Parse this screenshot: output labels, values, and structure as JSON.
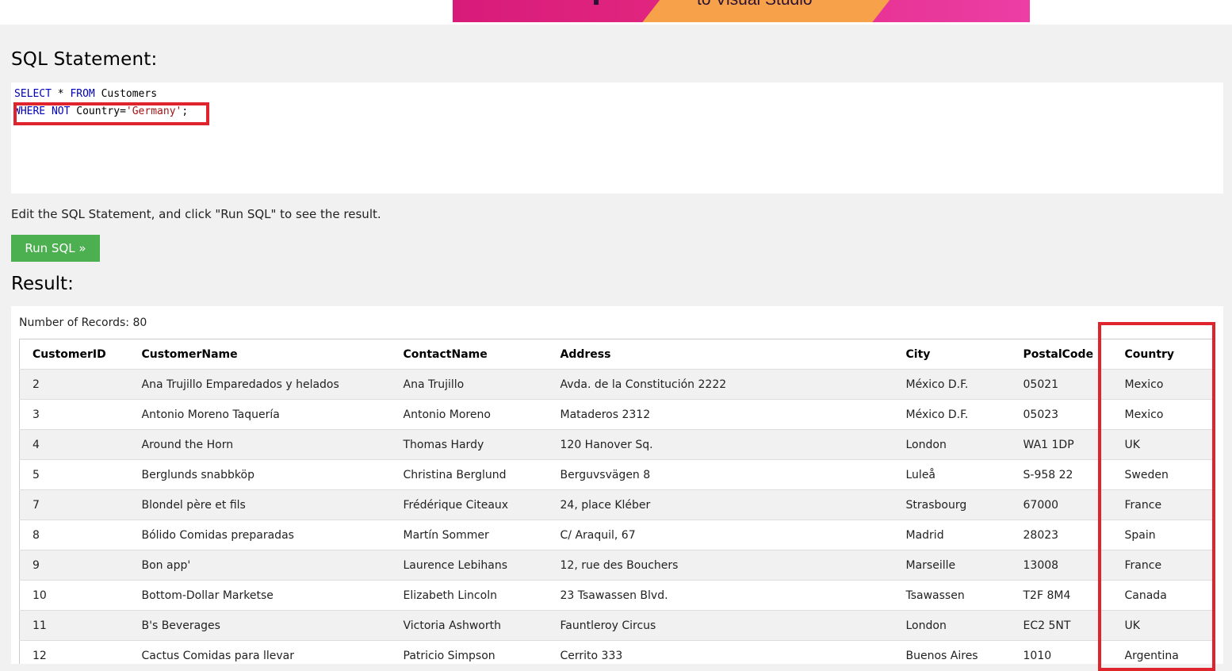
{
  "banner": {
    "text": "to Visual Studio"
  },
  "sql_heading": "SQL Statement:",
  "sql": {
    "line1": {
      "kw1": "SELECT",
      "mid": " * ",
      "kw2": "FROM",
      "rest": " Customers"
    },
    "line2": {
      "kw1": "WHERE",
      "mid": " ",
      "kw2": "NOT",
      "rest": " Country=",
      "str": "'Germany'",
      "end": ";"
    }
  },
  "hint": "Edit the SQL Statement, and click \"Run SQL\" to see the result.",
  "run_button": "Run SQL »",
  "result_heading": "Result:",
  "records_text": "Number of Records: 80",
  "table": {
    "headers": [
      "CustomerID",
      "CustomerName",
      "ContactName",
      "Address",
      "City",
      "PostalCode",
      "Country"
    ],
    "rows": [
      [
        "2",
        "Ana Trujillo Emparedados y helados",
        "Ana Trujillo",
        "Avda. de la Constitución 2222",
        "México D.F.",
        "05021",
        "Mexico"
      ],
      [
        "3",
        "Antonio Moreno Taquería",
        "Antonio Moreno",
        "Mataderos 2312",
        "México D.F.",
        "05023",
        "Mexico"
      ],
      [
        "4",
        "Around the Horn",
        "Thomas Hardy",
        "120 Hanover Sq.",
        "London",
        "WA1 1DP",
        "UK"
      ],
      [
        "5",
        "Berglunds snabbköp",
        "Christina Berglund",
        "Berguvsvägen 8",
        "Luleå",
        "S-958 22",
        "Sweden"
      ],
      [
        "7",
        "Blondel père et fils",
        "Frédérique Citeaux",
        "24, place Kléber",
        "Strasbourg",
        "67000",
        "France"
      ],
      [
        "8",
        "Bólido Comidas preparadas",
        "Martín Sommer",
        "C/ Araquil, 67",
        "Madrid",
        "28023",
        "Spain"
      ],
      [
        "9",
        "Bon app'",
        "Laurence Lebihans",
        "12, rue des Bouchers",
        "Marseille",
        "13008",
        "France"
      ],
      [
        "10",
        "Bottom-Dollar Marketse",
        "Elizabeth Lincoln",
        "23 Tsawassen Blvd.",
        "Tsawassen",
        "T2F 8M4",
        "Canada"
      ],
      [
        "11",
        "B's Beverages",
        "Victoria Ashworth",
        "Fauntleroy Circus",
        "London",
        "EC2 5NT",
        "UK"
      ],
      [
        "12",
        "Cactus Comidas para llevar",
        "Patricio Simpson",
        "Cerrito 333",
        "Buenos Aires",
        "1010",
        "Argentina"
      ]
    ]
  },
  "colors": {
    "button": "#4caf50",
    "highlight": "#e0242e",
    "keyword": "#0000b8",
    "string": "#a31515"
  }
}
